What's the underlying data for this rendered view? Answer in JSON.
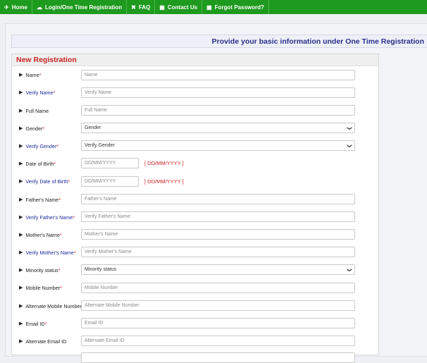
{
  "nav": [
    {
      "icon": "✈",
      "label": "Home"
    },
    {
      "icon": "☁",
      "label": "Login/One Time Registration"
    },
    {
      "icon": "✖",
      "label": "FAQ"
    },
    {
      "icon": "▦",
      "label": "Contact Us"
    },
    {
      "icon": "▦",
      "label": "Forgot Password?"
    }
  ],
  "info_text": "Provide your basic information under One Time Registration",
  "panel_title": "New Registration",
  "date_hint": "[ DD/MM/YYYY ]",
  "fields": [
    {
      "label": "Name",
      "req": "*",
      "placeholder": "Name"
    },
    {
      "label": "Verify Name",
      "req": "*",
      "placeholder": "Verify Name"
    },
    {
      "label": "Full Name",
      "req": "",
      "placeholder": "Full Name"
    },
    {
      "label": "Gender",
      "req": "*",
      "placeholder": "Gender"
    },
    {
      "label": "Verify Gender ",
      "req": "*",
      "placeholder": "Verify Gender"
    },
    {
      "label": "Date of Birth",
      "req": "*",
      "placeholder": "DD/MM/YYYY"
    },
    {
      "label": "Verify Date of Birth",
      "req": "*",
      "placeholder": "DD/MM/YYYY"
    },
    {
      "label": "Father's Name",
      "req": "*",
      "placeholder": "Father's Name"
    },
    {
      "label": "Verify Father's Name",
      "req": "*",
      "placeholder": "Verify Father's Name"
    },
    {
      "label": "Mother's Name",
      "req": "*",
      "placeholder": "Mother's Name"
    },
    {
      "label": "Verify Mother's Name",
      "req": "*",
      "placeholder": "Verify Mother's Name"
    },
    {
      "label": "Minority status",
      "req": "*",
      "placeholder": "Minority status"
    },
    {
      "label": "Mobile Number",
      "req": "*",
      "placeholder": "Mobile Number"
    },
    {
      "label": "Alternate Mobile Number",
      "req": "",
      "placeholder": "Alternate Mobile Number"
    },
    {
      "label": "Email ID",
      "req": "*",
      "placeholder": "Email ID"
    },
    {
      "label": "Alternate Email ID",
      "req": "",
      "placeholder": "Alternate Email ID"
    }
  ]
}
